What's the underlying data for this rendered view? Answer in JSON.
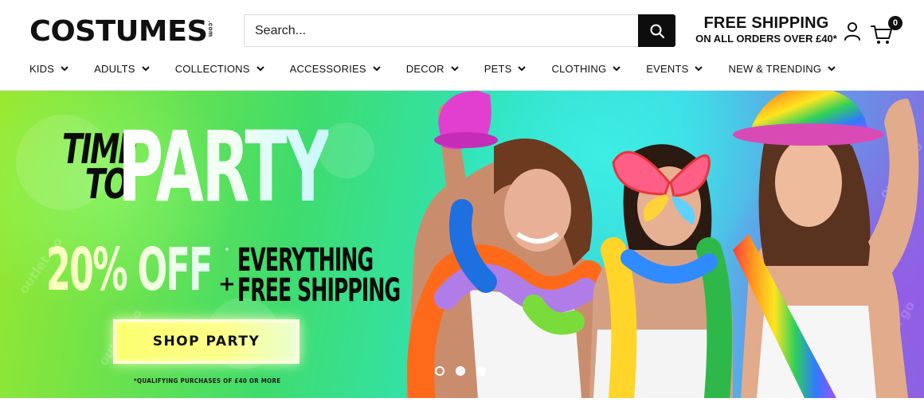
{
  "header": {
    "logo": {
      "main": "COSTUMES",
      "sub": ".com"
    },
    "search": {
      "placeholder": "Search..."
    },
    "shipping": {
      "title": "FREE SHIPPING",
      "subtitle": "ON ALL ORDERS OVER £40*"
    },
    "cart": {
      "count": "0"
    },
    "icons": {
      "search": "search-icon",
      "account": "user-icon",
      "cart": "cart-icon"
    }
  },
  "nav": {
    "items": [
      {
        "label": "KIDS"
      },
      {
        "label": "ADULTS"
      },
      {
        "label": "COLLECTIONS"
      },
      {
        "label": "ACCESSORIES"
      },
      {
        "label": "DECOR"
      },
      {
        "label": "PETS"
      },
      {
        "label": "CLOTHING"
      },
      {
        "label": "EVENTS"
      },
      {
        "label": "NEW & TRENDING"
      }
    ]
  },
  "hero": {
    "headline_small": "TIME TO",
    "headline_small_line1": "TIME",
    "headline_small_line2": "TO",
    "headline_big": "PARTY",
    "discount": "20% OFF",
    "discount_asterisk": "*",
    "plus": "+",
    "offer_line1": "EVERYTHING",
    "offer_line2": "FREE SHIPPING",
    "cta_label": "SHOP PARTY",
    "disclaimer": "*QUALIFYING PURCHASES OF £40 OR MORE",
    "watermark": "outlet go",
    "slides": {
      "count": 3,
      "active_index": 0
    },
    "colors": {
      "accent_yellow": "#fbff6e",
      "brand_dark": "#0d0d0d"
    }
  }
}
